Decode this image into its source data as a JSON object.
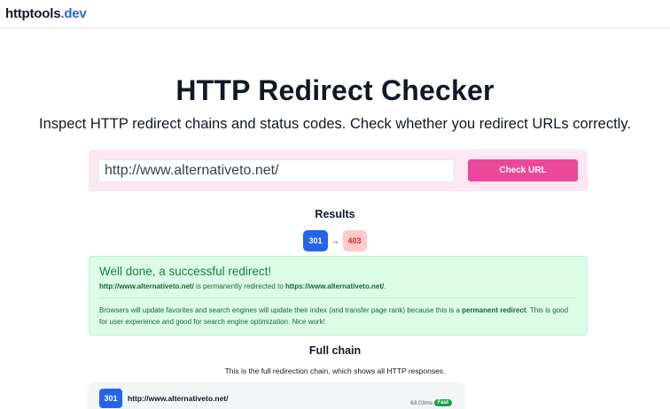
{
  "header": {
    "logo_main": "httptools",
    "logo_tld": ".dev"
  },
  "hero": {
    "title": "HTTP Redirect Checker",
    "subtitle": "Inspect HTTP redirect chains and status codes. Check whether you redirect URLs correctly."
  },
  "search": {
    "value": "http://www.alternativeto.net/",
    "button_label": "Check URL"
  },
  "results": {
    "title": "Results",
    "codes": [
      "301",
      "403"
    ],
    "arrow": "→"
  },
  "success": {
    "title": "Well done, a successful redirect!",
    "from_url": "http://www.alternativeto.net/",
    "middle_text": " is permanently redirected to ",
    "to_url": "https://www.alternativeto.net/",
    "end_text": ".",
    "desc_part1": "Browsers will update favorites and search engines will update their index (and transfer page rank) because this is a ",
    "desc_bold": "permanent redirect",
    "desc_part2": ". This is good for user experience and good for search engine optimization. Nice work!"
  },
  "chain": {
    "title": "Full chain",
    "subtitle": "This is the full redirection chain, which shows all HTTP responses.",
    "items": [
      {
        "code": "301",
        "url": "http://www.alternativeto.net/",
        "time": "63.03ms",
        "badge": "Fast"
      }
    ]
  },
  "colors": {
    "accent": "#2563eb",
    "button": "#ec4899",
    "success_bg": "#dcfce7",
    "error_bg": "#fecaca"
  }
}
